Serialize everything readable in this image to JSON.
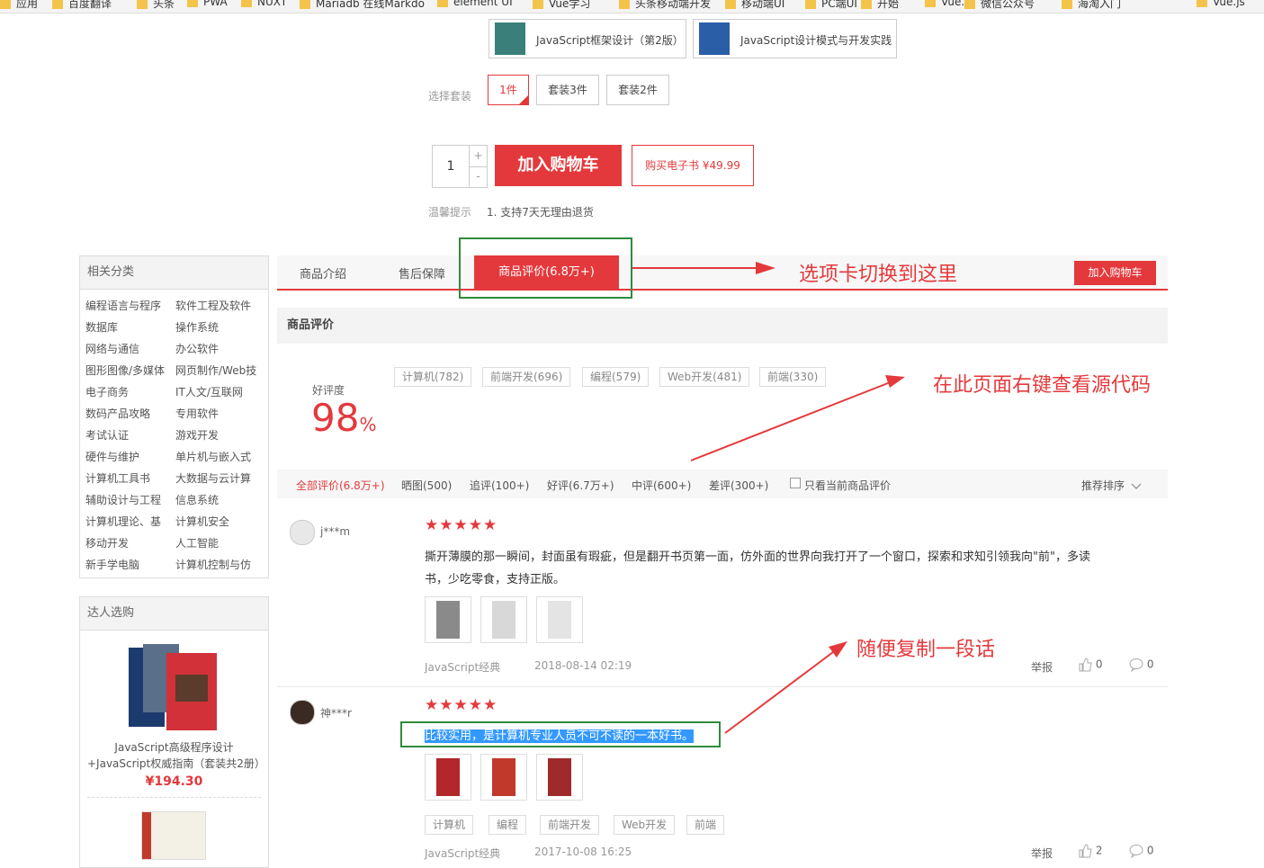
{
  "bookmarks": [
    "应用",
    "百度翻译",
    "头条",
    "PWA",
    "NUXT",
    "Mariadb 在线Markdo",
    "element UI",
    "Vue学习",
    "头条移动端开发",
    "移动端UI",
    "PC端UI",
    "开始",
    "Vue.js",
    "微信公众号",
    "海淘入门",
    "Vue.js"
  ],
  "related_books": [
    {
      "title": "JavaScript框架设计（第2版）"
    },
    {
      "title": "JavaScript设计模式与开发实践"
    }
  ],
  "package": {
    "label": "选择套装",
    "options": [
      "1件",
      "套装3件",
      "套装2件"
    ],
    "selected": "1件"
  },
  "purchase": {
    "quantity": "1",
    "plus": "+",
    "minus": "-",
    "add_to_cart": "加入购物车",
    "ebook": "购买电子书 ¥49.99"
  },
  "tip": {
    "label": "温馨提示",
    "text": "1.  支持7天无理由退货"
  },
  "sidebar": {
    "categories_title": "相关分类",
    "categories": [
      [
        "编程语言与程序",
        "软件工程及软件"
      ],
      [
        "数据库",
        "操作系统"
      ],
      [
        "网络与通信",
        "办公软件"
      ],
      [
        "图形图像/多媒体",
        "网页制作/Web技"
      ],
      [
        "电子商务",
        "IT人文/互联网"
      ],
      [
        "数码产品攻略",
        "专用软件"
      ],
      [
        "考试认证",
        "游戏开发"
      ],
      [
        "硬件与维护",
        "单片机与嵌入式"
      ],
      [
        "计算机工具书",
        "大数据与云计算"
      ],
      [
        "辅助设计与工程",
        "信息系统"
      ],
      [
        "计算机理论、基",
        "计算机安全"
      ],
      [
        "移动开发",
        "人工智能"
      ],
      [
        "新手学电脑",
        "计算机控制与仿"
      ]
    ],
    "picks_title": "达人选购",
    "pick": {
      "name": "JavaScript高级程序设计+JavaScript权威指南（套装共2册）",
      "price": "¥194.30"
    }
  },
  "tabs": {
    "items": [
      "商品介绍",
      "售后保障",
      "商品评价(6.8万+)"
    ],
    "active": "商品评价(6.8万+)",
    "add_to_cart": "加入购物车"
  },
  "reviews": {
    "section_title": "商品评价",
    "rating_label": "好评度",
    "rating_value": "98",
    "rating_unit": "%",
    "tags": [
      "计算机(782)",
      "前端开发(696)",
      "编程(579)",
      "Web开发(481)",
      "前端(330)"
    ],
    "filters": [
      "全部评价(6.8万+)",
      "晒图(500)",
      "追评(100+)",
      "好评(6.7万+)",
      "中评(600+)",
      "差评(300+)"
    ],
    "only_current": "只看当前商品评价",
    "sort": "推荐排序",
    "stars": "★★★★★",
    "items": [
      {
        "user": "j***m",
        "rating": 5,
        "text_line1": "撕开薄膜的那一瞬间，封面虽有瑕疵，但是翻开书页第一面，仿外面的世界向我打开了一个窗口，探索和求知引领我向\"前\"，多读",
        "text_line2": "书，少吃零食，支持正版。",
        "product": "JavaScript经典",
        "date": "2018-08-14 02:19",
        "report": "举报",
        "likes": "0",
        "comments": "0"
      },
      {
        "user": "神***r",
        "rating": 5,
        "text": "比较实用，是计算机专业人员不可不读的一本好书。",
        "tags": [
          "计算机",
          "编程",
          "前端开发",
          "Web开发",
          "前端"
        ],
        "product": "JavaScript经典",
        "date": "2017-10-08 16:25",
        "report": "举报",
        "likes": "2",
        "comments": "0"
      }
    ]
  },
  "annotations": {
    "switch_tab": "选项卡切换到这里",
    "view_source": "在此页面右键查看源代码",
    "copy_text": "随便复制一段话"
  },
  "colors": {
    "accent": "#e4393c",
    "annotation_box": "#2e8b3e",
    "selection": "#3399ff"
  }
}
